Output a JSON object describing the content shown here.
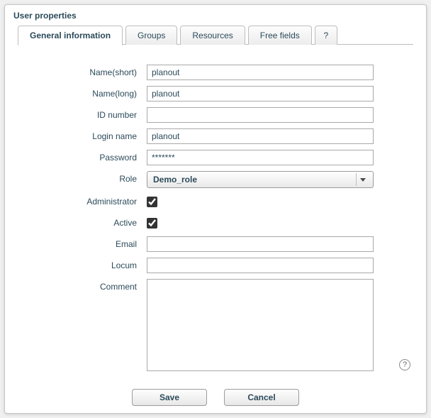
{
  "panel": {
    "title": "User properties"
  },
  "tabs": {
    "general": "General information",
    "groups": "Groups",
    "resources": "Resources",
    "freefields": "Free fields",
    "help": "?"
  },
  "labels": {
    "name_short": "Name(short)",
    "name_long": "Name(long)",
    "id_number": "ID number",
    "login_name": "Login name",
    "password": "Password",
    "role": "Role",
    "administrator": "Administrator",
    "active": "Active",
    "email": "Email",
    "locum": "Locum",
    "comment": "Comment"
  },
  "values": {
    "name_short": "planout",
    "name_long": "planout",
    "id_number": "",
    "login_name": "planout",
    "password": "*******",
    "role": "Demo_role",
    "administrator": true,
    "active": true,
    "email": "",
    "locum": "",
    "comment": ""
  },
  "buttons": {
    "save": "Save",
    "cancel": "Cancel"
  },
  "help_icon": "?"
}
